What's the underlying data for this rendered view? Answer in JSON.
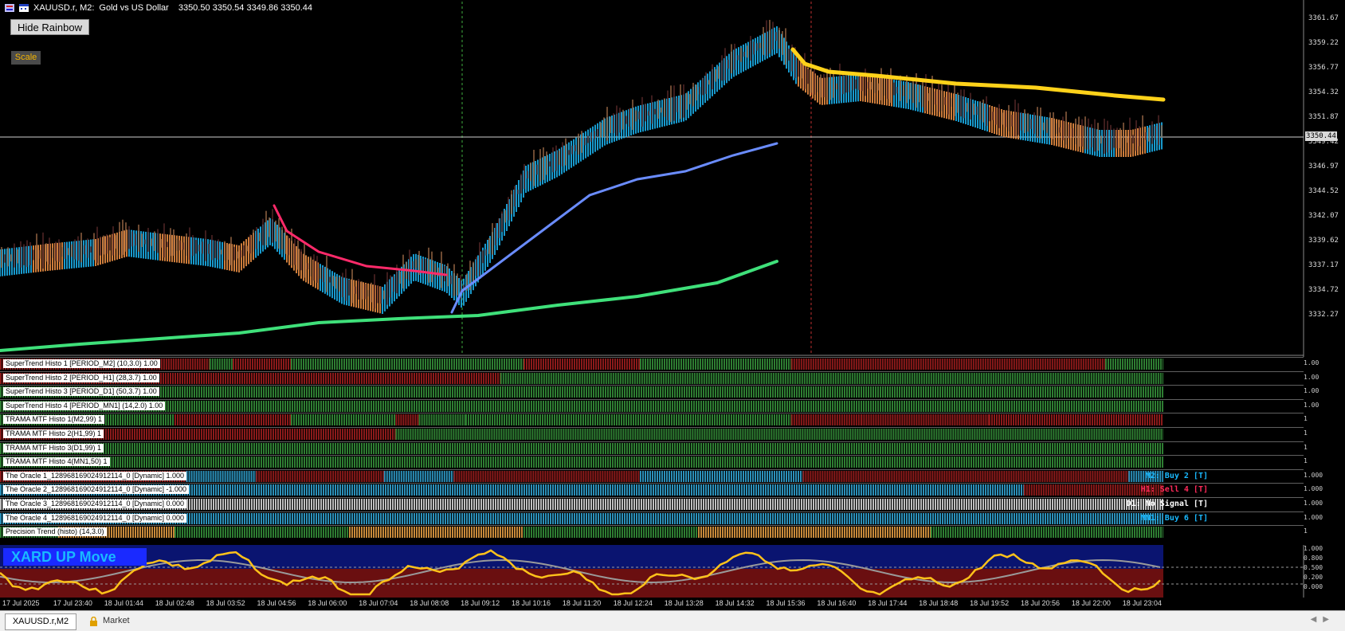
{
  "header": {
    "symbol": "XAUUSD.r, M2:",
    "description": "Gold vs US Dollar",
    "ohlc": "3350.50 3350.54 3349.86 3350.44"
  },
  "buttons": {
    "hide_rainbow": "Hide Rainbow",
    "scale": "Scale"
  },
  "price_axis": {
    "labels": [
      "3361.67",
      "3359.22",
      "3356.77",
      "3354.32",
      "3351.87",
      "3349.42",
      "3346.97",
      "3344.52",
      "3342.07",
      "3339.62",
      "3337.17",
      "3334.72",
      "3332.27"
    ],
    "bid": "3350.44"
  },
  "colors": {
    "bull": "#2e7d32",
    "bear": "#8b1a1a",
    "oracle_buy": "#2b8fb8",
    "oracle_sell": "#8b1a2a",
    "rainbow_blue": "#1ec0ff",
    "rainbow_orange": "#ff9b4a",
    "ma_yellow": "#ffd21a",
    "ma_green": "#3fe07a",
    "ma_pink": "#ff2a6a",
    "ma_blue": "#6a8cff"
  },
  "indicators": [
    {
      "label": "SuperTrend Histo 1 [PERIOD_M2] (10,3.0) 1.00",
      "axis": "1.00"
    },
    {
      "label": "SuperTrend Histo 2 [PERIOD_H1] (28,3.7) 1.00",
      "axis": "1.00"
    },
    {
      "label": "SuperTrend Histo 3 [PERIOD_D1] (50,3.7) 1.00",
      "axis": "1.00"
    },
    {
      "label": "SuperTrend Histo 4 [PERIOD_MN1] (14,2.0) 1.00",
      "axis": "1.00"
    },
    {
      "label": "TRAMA MTF Histo 1(M2,99) 1",
      "axis": "1"
    },
    {
      "label": "TRAMA MTF Histo 2(H1,99) 1",
      "axis": "1"
    },
    {
      "label": "TRAMA MTF Histo 3(D1,99) 1",
      "axis": "1"
    },
    {
      "label": "TRAMA MTF Histo 4(MN1,50) 1",
      "axis": "1"
    },
    {
      "label": "The Oracle 1_128968169024912114_0 [Dynamic] 1.000",
      "axis": "1.000",
      "signal": "M2: Buy 2 [T]",
      "signal_color": "#19b9ff"
    },
    {
      "label": "The Oracle 2_128968169024912114_0 [Dynamic] -1.000",
      "axis": "1.000",
      "signal": "H1: Sell 4 [T]",
      "signal_color": "#ff2a5a"
    },
    {
      "label": "The Oracle 3_128968169024912114_0 [Dynamic] 0.000",
      "axis": "1.000",
      "signal": "D1: No Signal [T]",
      "signal_color": "#ffffff"
    },
    {
      "label": "The Oracle 4_128968169024912114_0 [Dynamic] 0.000",
      "axis": "1.000",
      "signal": "MN1: Buy 6 [T]",
      "signal_color": "#19b9ff"
    },
    {
      "label": "Precision Trend (histo) (14,3.0)",
      "axis": "1"
    }
  ],
  "oscillator": {
    "title": "XARD UP Move",
    "axis": [
      "1.000",
      "0.800",
      "0.500",
      "0.200",
      "0.000"
    ]
  },
  "time_axis": [
    "17 Jul 2025",
    "17 Jul 23:40",
    "18 Jul 01:44",
    "18 Jul 02:48",
    "18 Jul 03:52",
    "18 Jul 04:56",
    "18 Jul 06:00",
    "18 Jul 07:04",
    "18 Jul 08:08",
    "18 Jul 09:12",
    "18 Jul 10:16",
    "18 Jul 11:20",
    "18 Jul 12:24",
    "18 Jul 13:28",
    "18 Jul 14:32",
    "18 Jul 15:36",
    "18 Jul 16:40",
    "18 Jul 17:44",
    "18 Jul 18:48",
    "18 Jul 19:52",
    "18 Jul 20:56",
    "18 Jul 22:00",
    "18 Jul 23:04"
  ],
  "tabs": {
    "active": "XAUUSD.r,M2",
    "market": "Market"
  }
}
